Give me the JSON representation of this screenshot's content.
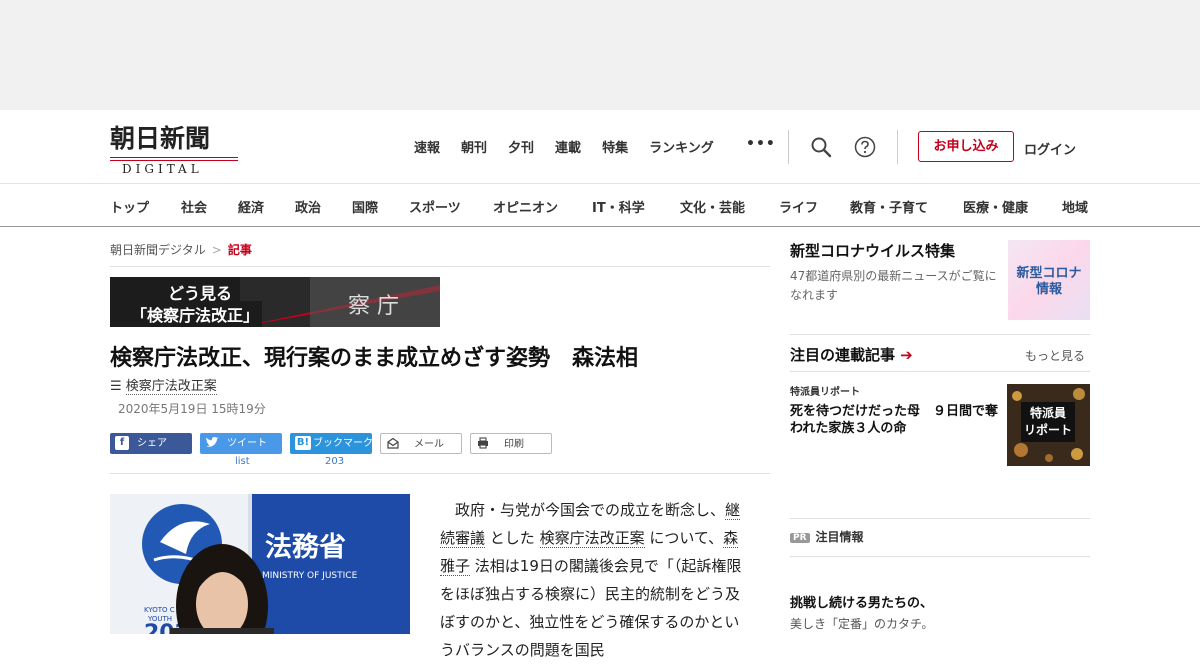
{
  "header": {
    "logo_main": "朝日新聞",
    "logo_sub": "DIGITAL",
    "nav": [
      "速報",
      "朝刊",
      "夕刊",
      "連載",
      "特集",
      "ランキング"
    ],
    "more": "•••",
    "signup": "お申し込み",
    "login": "ログイン"
  },
  "categories": [
    "トップ",
    "社会",
    "経済",
    "政治",
    "国際",
    "スポーツ",
    "オピニオン",
    "IT・科学",
    "文化・芸能",
    "ライフ",
    "教育・子育て",
    "医療・健康",
    "地域"
  ],
  "breadcrumb": {
    "home": "朝日新聞デジタル",
    "sep": ">",
    "current": "記事"
  },
  "banner": {
    "line1": "どう見る",
    "line2": "「検察庁法改正」",
    "photo_text": "察 庁"
  },
  "article": {
    "title": "検察庁法改正、現行案のまま成立めざす姿勢　森法相",
    "series_icon": "☰",
    "series": "検察庁法改正案",
    "date": "2020年5月19日 15時19分",
    "body": [
      {
        "text": "　政府・与党が今国会での成立を断念し、",
        "link": false
      },
      {
        "text": "継続審議",
        "link": true
      },
      {
        "text": " とした ",
        "link": false
      },
      {
        "text": "検察庁法改正案",
        "link": true
      },
      {
        "text": " について、",
        "link": false
      },
      {
        "text": "森雅子",
        "link": true
      },
      {
        "text": " 法相は19日の閣議後会見で「（起訴権限をほぼ独占する検察に）民主的統制をどう及ぼすのかと、独立性をどう確保するのかというバランスの問題を国民",
        "link": false
      }
    ],
    "photo_sign": "法務省",
    "photo_sign_en": "MINISTRY OF JUSTICE",
    "photo_kyoto": "KYOTO C",
    "photo_youth": "YOUTH",
    "photo_year": "202"
  },
  "share": {
    "facebook": "シェア",
    "twitter": "ツイート",
    "twitter_count": "list",
    "hatena": "ブックマーク",
    "hatena_count": "203",
    "mail": "メール",
    "print": "印刷"
  },
  "sidebar": {
    "covid_title": "新型コロナウイルス特集",
    "covid_desc": "47都道府県別の最新ニュースがご覧になれます",
    "covid_badge_1": "新型コロナ",
    "covid_badge_2": "情報",
    "series_heading": "注目の連載記事",
    "series_arrow": "➔",
    "more": "もっと見る",
    "featured_label": "特派員リポート",
    "featured_title": "死を待つだけだった母　９日間で奪われた家族３人の命",
    "featured_thumb_1": "特派員",
    "featured_thumb_2": "リポート",
    "pr_badge": "PR",
    "pr_heading": "注目情報",
    "promo_title": "挑戦し続ける男たちの、",
    "promo_sub": "美しき「定番」のカタチ。"
  },
  "colors": {
    "brand_red": "#c4001c",
    "facebook": "#3b5998",
    "twitter": "#4a99e9",
    "hatena": "#2c94dd"
  }
}
